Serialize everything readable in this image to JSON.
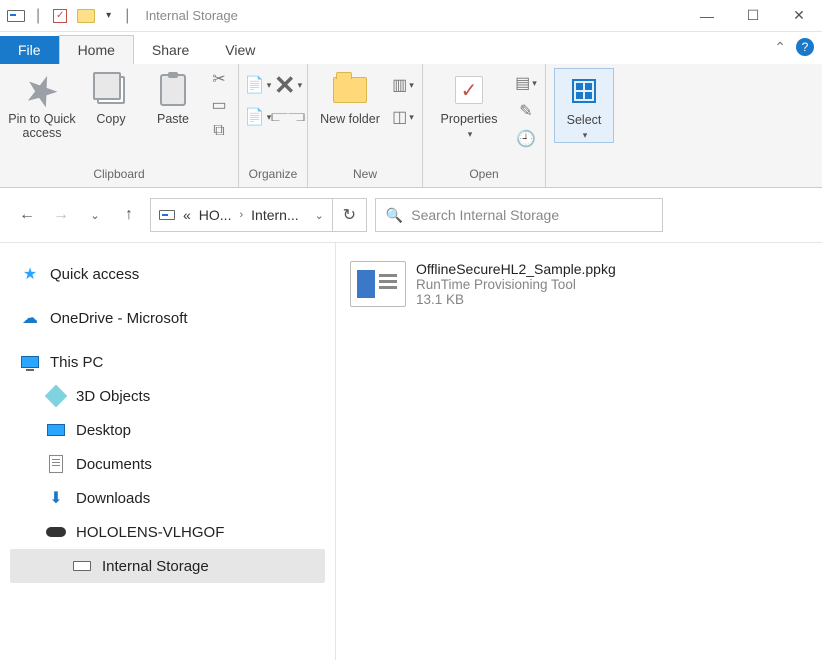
{
  "window": {
    "title": "Internal Storage"
  },
  "tabs": {
    "file": "File",
    "home": "Home",
    "share": "Share",
    "view": "View"
  },
  "ribbon": {
    "pin": "Pin to Quick access",
    "copy": "Copy",
    "paste": "Paste",
    "group_clipboard": "Clipboard",
    "group_organize": "Organize",
    "newfolder": "New folder",
    "group_new": "New",
    "properties": "Properties",
    "group_open": "Open",
    "select": "Select"
  },
  "address": {
    "pre": "«",
    "seg1": "HO...",
    "seg2": "Intern..."
  },
  "search": {
    "placeholder": "Search Internal Storage"
  },
  "nav": {
    "quick_access": "Quick access",
    "onedrive": "OneDrive - Microsoft",
    "this_pc": "This PC",
    "three_d": "3D Objects",
    "desktop": "Desktop",
    "documents": "Documents",
    "downloads": "Downloads",
    "hololens": "HOLOLENS-VLHGOF",
    "internal": "Internal Storage"
  },
  "file": {
    "name": "OfflineSecureHL2_Sample.ppkg",
    "type": "RunTime Provisioning Tool",
    "size": "13.1 KB"
  }
}
